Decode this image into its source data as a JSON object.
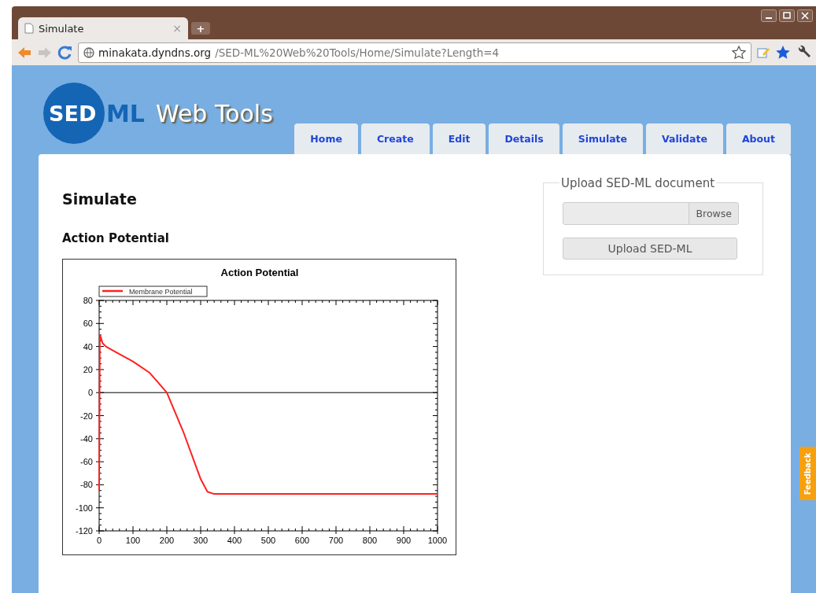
{
  "browser": {
    "tab": {
      "title": "Simulate",
      "close": "×"
    },
    "new_tab": "+",
    "address": {
      "host": "minakata.dyndns.org",
      "path": "/SED-ML%20Web%20Tools/Home/Simulate?Length=4"
    }
  },
  "site": {
    "logo": {
      "part_1": "SED",
      "part_2": "ML",
      "tagline": "Web Tools"
    },
    "nav": [
      {
        "label": "Home",
        "selected": false
      },
      {
        "label": "Create",
        "selected": false
      },
      {
        "label": "Edit",
        "selected": false
      },
      {
        "label": "Details",
        "selected": false
      },
      {
        "label": "Simulate",
        "selected": false
      },
      {
        "label": "Validate",
        "selected": false
      },
      {
        "label": "About",
        "selected": false
      }
    ]
  },
  "main": {
    "heading": "Simulate",
    "subheading": "Action Potential",
    "chart_data": {
      "type": "line",
      "title": "Action Potential",
      "x": [
        0,
        2,
        5,
        10,
        20,
        50,
        100,
        150,
        200,
        250,
        300,
        320,
        340,
        400,
        500,
        600,
        700,
        800,
        900,
        1000
      ],
      "series": [
        {
          "name": "Membrane Potential",
          "color": "#ff2020",
          "values": [
            -85,
            50,
            48,
            43,
            40,
            35,
            27,
            17,
            0,
            -35,
            -75,
            -86,
            -88,
            -88,
            -88,
            -88,
            -88,
            -88,
            -88,
            -88
          ]
        }
      ],
      "xlim": [
        0,
        1000
      ],
      "ylim": [
        -120,
        80
      ],
      "xticks": [
        0,
        100,
        200,
        300,
        400,
        500,
        600,
        700,
        800,
        900,
        1000
      ],
      "yticks": [
        -120,
        -100,
        -80,
        -60,
        -40,
        -20,
        0,
        20,
        40,
        60,
        80
      ]
    }
  },
  "upload": {
    "legend": "Upload SED-ML document",
    "browse": "Browse",
    "submit": "Upload SED-ML"
  },
  "feedback": "Feedback"
}
